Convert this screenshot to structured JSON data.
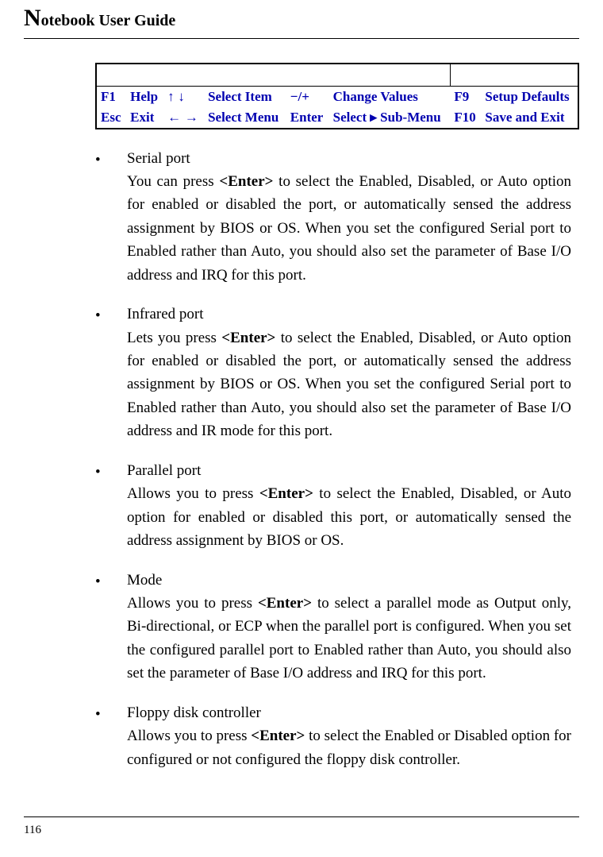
{
  "header": {
    "title_prefix": "N",
    "title_rest": "otebook User Guide"
  },
  "bios_keys": {
    "r1": {
      "k1": "F1",
      "a1": "Help",
      "k2_arrows": "↑ ↓",
      "a2": "Select Item",
      "k3": "−/+",
      "a3": "Change Values",
      "k4": "F9",
      "a4": "Setup Defaults"
    },
    "r2": {
      "k1": "Esc",
      "a1": "Exit",
      "k2_arrows": "← →",
      "a2": "Select Menu",
      "k3": "Enter",
      "a3": "Select  ▸ Sub-Menu",
      "k4": "F10",
      "a4": "Save and Exit"
    }
  },
  "items": [
    {
      "title": "Serial port",
      "pre": "You can press ",
      "kbd": "<Enter>",
      "post": " to select the Enabled, Disabled, or Auto option for enabled or disabled the port, or automatically sensed the address assignment by BIOS or OS. When you set the configured Serial port to Enabled rather than Auto, you should also set the parameter of Base I/O address and IRQ for this port."
    },
    {
      "title": "Infrared port",
      "pre": "Lets you press ",
      "kbd": "<Enter>",
      "post": " to select the Enabled, Disabled, or Auto option for enabled or disabled the port, or automatically sensed the address assignment by BIOS or OS. When you set the configured Serial port to Enabled rather than Auto, you should also set the parameter of Base I/O address and IR mode for this port."
    },
    {
      "title": "Parallel port",
      "pre": "Allows you to press ",
      "kbd": "<Enter>",
      "post": " to select the Enabled, Disabled, or Auto option for enabled or disabled this port, or automatically sensed the address assignment by BIOS or OS."
    },
    {
      "title": "Mode",
      "pre": "Allows you to press ",
      "kbd": "<Enter>",
      "post": " to select a parallel mode as Output only, Bi-directional, or ECP when the parallel port is configured. When you set the configured parallel port to Enabled rather than Auto, you should also set the parameter of Base I/O address and IRQ for this port."
    },
    {
      "title": "Floppy disk controller",
      "pre": "Allows you to press ",
      "kbd": "<Enter>",
      "post": " to select the Enabled or Disabled option for configured or not configured the floppy disk controller."
    }
  ],
  "page_number": "116"
}
